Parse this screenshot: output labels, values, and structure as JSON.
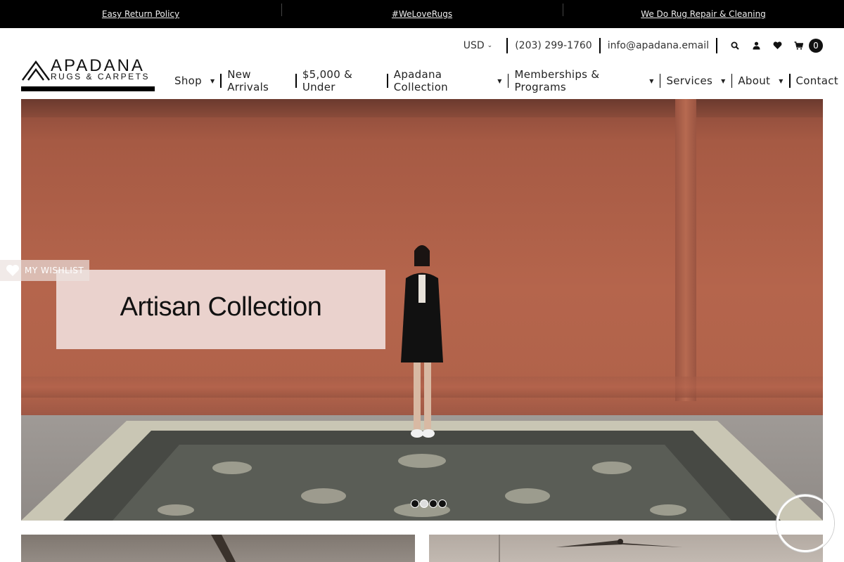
{
  "announcement": {
    "items": [
      "Easy Return Policy",
      "#WeLoveRugs",
      "We Do Rug Repair & Cleaning"
    ]
  },
  "utility": {
    "currency": "USD",
    "phone": "(203) 299-1760",
    "email": "info@apadana.email",
    "cart_count": "0",
    "icons": [
      "search-icon",
      "user-icon",
      "heart-icon",
      "cart-icon"
    ]
  },
  "logo": {
    "main": "APADANA",
    "sub": "RUGS & CARPETS"
  },
  "nav": {
    "items": [
      {
        "label": "Shop",
        "dropdown": true
      },
      {
        "label": "New Arrivals",
        "dropdown": false
      },
      {
        "label": "$5,000 & Under",
        "dropdown": false
      },
      {
        "label": "Apadana Collection",
        "dropdown": true
      },
      {
        "label": "Memberships & Programs",
        "dropdown": true
      },
      {
        "label": "Services",
        "dropdown": true
      },
      {
        "label": "About",
        "dropdown": true
      },
      {
        "label": "Contact",
        "dropdown": false
      }
    ]
  },
  "hero": {
    "title": "Artisan Collection",
    "slide_count": 4,
    "active_slide": 2
  },
  "wishlist_tab": {
    "label": "MY WISHLIST"
  },
  "colors": {
    "announce_bg": "#000000",
    "hero_wall": "#b5654c",
    "label_bg": "#f0dedc"
  }
}
